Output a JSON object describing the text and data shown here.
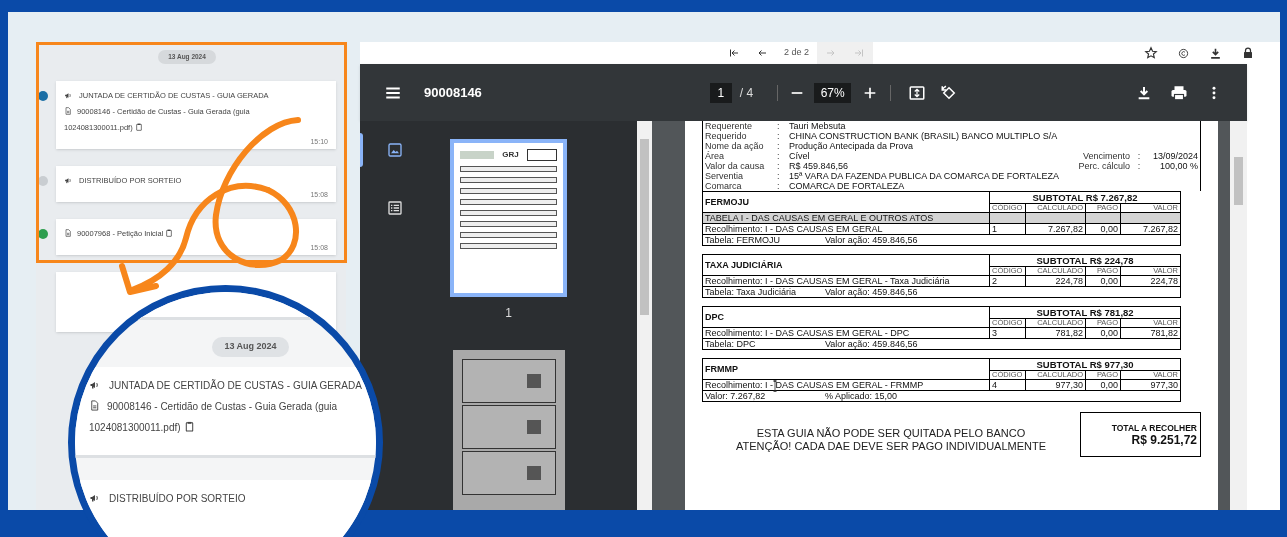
{
  "timeline": {
    "date": "13 Aug 2024",
    "items": [
      {
        "color": "#1b6fa6",
        "title": "JUNTADA DE CERTIDÃO DE CUSTAS - GUIA GERADA",
        "document": "90008146 - Certidão de Custas - Guia Gerada (guia 1024081300011.pdf)",
        "time": "15:10"
      },
      {
        "color": "#c9cdd1",
        "title": "DISTRIBUÍDO POR SORTEIO",
        "time": "15:08"
      },
      {
        "color": "#2e9e4f",
        "document": "90007968 - Petição Inicial",
        "time": "15:08"
      }
    ]
  },
  "magnifier": {
    "date": "13 Aug 2024",
    "items": [
      {
        "title": "JUNTADA DE CERTIDÃO DE CUSTAS - GUIA GERADA",
        "document": "90008146 - Certidão de Custas - Guia Gerada (guia 1024081300011.pdf)"
      },
      {
        "title": "DISTRIBUÍDO POR SORTEIO"
      }
    ]
  },
  "viewer_nav": {
    "page_label": "2 de 2",
    "buttons": [
      {
        "kind": "first",
        "disabled": false
      },
      {
        "kind": "prev",
        "disabled": false
      },
      {
        "kind": "next",
        "disabled": true
      },
      {
        "kind": "last",
        "disabled": true
      }
    ]
  },
  "pdf_toolbar": {
    "title": "90008146",
    "page": "1",
    "page_total": "/ 4",
    "zoom": "67%"
  },
  "sidebar": {
    "views": [
      {
        "kind": "thumbnails",
        "selected": true
      },
      {
        "kind": "outline",
        "selected": false
      }
    ],
    "thumbnails": [
      {
        "kind": "form",
        "label": "1",
        "heading": "GRJ",
        "selected": true
      },
      {
        "kind": "slips",
        "selected": false
      }
    ]
  },
  "document": {
    "header": [
      {
        "label": "Requerente",
        "sep": ":",
        "value": "Tauri Mebsuta"
      },
      {
        "label": "Requerido",
        "sep": ":",
        "value": "CHINA CONSTRUCTION BANK (BRASIL) BANCO MULTIPLO S/A"
      },
      {
        "label": "Nome da ação",
        "sep": ":",
        "value": "Produção Antecipada da Prova"
      },
      {
        "label": "Área",
        "sep": ":",
        "value": "Cível",
        "side_label": "Vencimento",
        "side_sep": ":",
        "side_value": "13/09/2024"
      },
      {
        "label": "Valor da causa",
        "sep": ":",
        "value": "R$ 459.846,56",
        "side_label": "Perc. cálculo",
        "side_sep": ":",
        "side_value": "100,00 %"
      },
      {
        "label": "Serventia",
        "sep": ":",
        "value": "15ª VARA DA FAZENDA PUBLICA DA COMARCA DE FORTALEZA"
      },
      {
        "label": "Comarca",
        "sep": ":",
        "value": "COMARCA DE FORTALEZA"
      }
    ],
    "sections": [
      {
        "name": "FERMOJU",
        "subtotal": "SUBTOTAL R$ 7.267,82",
        "columns": [
          "CÓDIGO",
          "CALCULADO",
          "PAGO",
          "VALOR"
        ],
        "group": "TABELA I - DAS CAUSAS EM GERAL E OUTROS ATOS",
        "row": [
          "Recolhimento: I - DAS CAUSAS EM GERAL",
          "1",
          "7.267,82",
          "0,00",
          "7.267,82"
        ],
        "footer": [
          "Tabela: FERMOJU",
          "Valor ação: 459.846,56"
        ]
      },
      {
        "name": "TAXA JUDICIÁRIA",
        "subtotal": "SUBTOTAL R$ 224,78",
        "columns": [
          "CÓDIGO",
          "CALCULADO",
          "PAGO",
          "VALOR"
        ],
        "row": [
          "Recolhimento: I - DAS CAUSAS EM GERAL - Taxa Judiciária",
          "2",
          "224,78",
          "0,00",
          "224,78"
        ],
        "footer": [
          "Tabela: Taxa Judiciária",
          "Valor ação: 459.846,56"
        ]
      },
      {
        "name": "DPC",
        "subtotal": "SUBTOTAL R$ 781,82",
        "columns": [
          "CÓDIGO",
          "CALCULADO",
          "PAGO",
          "VALOR"
        ],
        "row": [
          "Recolhimento: I - DAS CAUSAS EM GERAL - DPC",
          "3",
          "781,82",
          "0,00",
          "781,82"
        ],
        "footer": [
          "Tabela: DPC",
          "Valor ação: 459.846,56"
        ]
      },
      {
        "name": "FRMMP",
        "subtotal": "SUBTOTAL R$ 977,30",
        "columns": [
          "CÓDIGO",
          "CALCULADO",
          "PAGO",
          "VALOR"
        ],
        "row": [
          "Recolhimento: I - DAS CAUSAS EM GERAL - FRMMP",
          "4",
          "977,30",
          "0,00",
          "977,30"
        ],
        "footer": [
          "Valor: 7.267,82",
          "% Aplicado: 15,00"
        ],
        "cursor": true
      }
    ],
    "notice": [
      "ESTA GUIA NÃO PODE SER QUITADA PELO BANCO",
      "ATENÇÃO! CADA DAE DEVE SER PAGO INDIVIDUALMENTE"
    ],
    "total": {
      "label": "TOTAL A RECOLHER",
      "value": "R$ 9.251,72"
    }
  }
}
